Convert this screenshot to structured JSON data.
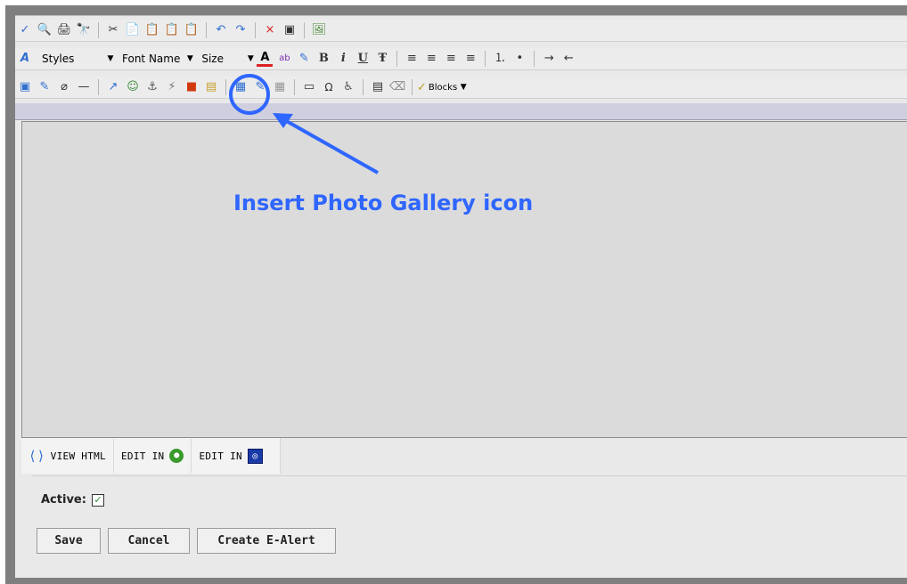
{
  "toolbar_row1": {
    "icons": [
      "spellcheck-icon",
      "find-icon",
      "print-icon",
      "binoculars-icon",
      "cut-icon",
      "copy-icon",
      "paste-icon",
      "paste-text-icon",
      "paste-word-icon",
      "undo-icon",
      "redo-icon",
      "delete-icon",
      "select-all-icon",
      "presentation-icon"
    ],
    "glyphs": [
      "✓",
      "🔍",
      "🖨",
      "🔭",
      "✂",
      "📄",
      "📋",
      "📋",
      "📋",
      "↶",
      "↷",
      "×",
      "▣",
      "🖼"
    ]
  },
  "toolbar_row2": {
    "styles_label": "Styles",
    "fontname_label": "Font Name",
    "size_label": "Size",
    "icons": [
      "font-color-icon",
      "highlight-icon",
      "eraser-format-icon",
      "bold-icon",
      "italic-icon",
      "underline-icon",
      "strikethrough-icon",
      "align-left-icon",
      "align-center-icon",
      "align-right-icon",
      "align-justify-icon",
      "ordered-list-icon",
      "unordered-list-icon",
      "indent-icon",
      "outdent-icon"
    ],
    "glyphs": [
      "A",
      "ab",
      "✎",
      "B",
      "i",
      "U",
      "Ŧ",
      "≡",
      "≡",
      "≡",
      "≡",
      "⒈",
      "•",
      "→",
      "←"
    ]
  },
  "toolbar_row3": {
    "icons": [
      "image-icon",
      "edit-image-icon",
      "attachment-icon",
      "horizontal-rule-icon",
      "link-icon",
      "web-link-icon",
      "anchor-icon",
      "flash-icon",
      "photo-gallery-icon",
      "media-icon",
      "table-icon",
      "table-edit-icon",
      "table-cells-icon",
      "form-icon",
      "special-char-icon",
      "accessibility-icon",
      "template-icon",
      "clear-format-icon",
      "blocks-icon"
    ],
    "glyphs": [
      "▣",
      "✎",
      "⌀",
      "—",
      "↗",
      "☺",
      "⚓",
      "⚡",
      "■",
      "▤",
      "▦",
      "✎",
      "▦",
      "▭",
      "Ω",
      "♿",
      "▤",
      "⌫",
      "✓"
    ],
    "blocks_label": "Blocks"
  },
  "tabs": {
    "view_html": "VIEW HTML",
    "edit_in_1": "EDIT IN",
    "edit_in_2": "EDIT IN"
  },
  "form": {
    "active_label": "Active:",
    "active_checked": true
  },
  "buttons": {
    "save": "Save",
    "cancel": "Cancel",
    "create_alert": "Create E-Alert"
  },
  "annotation": {
    "callout_text": "Insert Photo Gallery icon",
    "color": "#2f66ff"
  }
}
